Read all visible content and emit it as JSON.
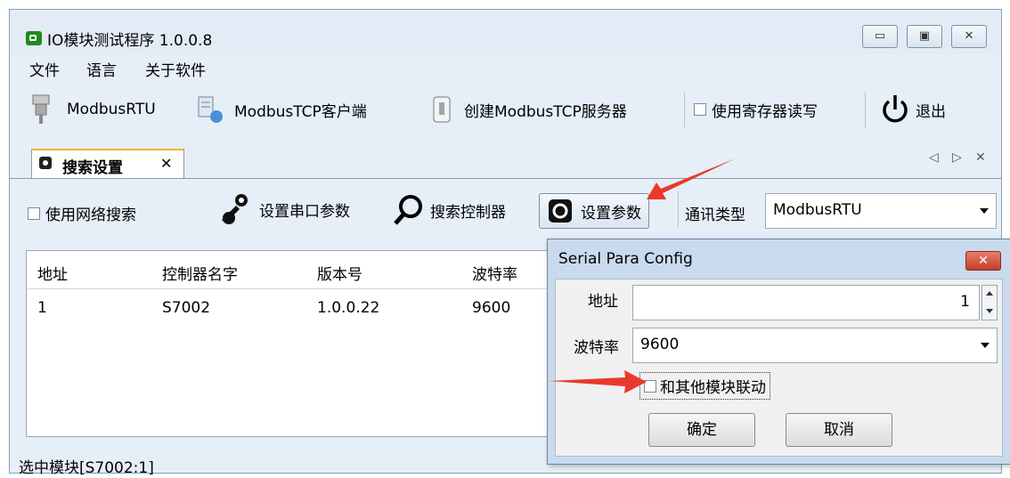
{
  "window": {
    "title": "IO模块测试程序 1.0.0.8",
    "minimize": "▭",
    "maximize": "▣",
    "close": "✕"
  },
  "menu": {
    "items": [
      "文件",
      "语言",
      "关于软件"
    ]
  },
  "toolbar": {
    "modbus_rtu": "ModbusRTU",
    "modbus_tcp_client": "ModbusTCP客户端",
    "create_tcp_server": "创建ModbusTCP服务器",
    "use_register": "使用寄存器读写",
    "exit": "退出"
  },
  "tab": {
    "label": "搜索设置",
    "close": "✕",
    "nav_prev": "◁",
    "nav_next": "▷",
    "nav_close": "✕"
  },
  "search": {
    "use_network": "使用网络搜索",
    "set_serial": "设置串口参数",
    "search_controller": "搜索控制器",
    "set_params": "设置参数",
    "comm_type_label": "通讯类型",
    "comm_type_value": "ModbusRTU"
  },
  "grid": {
    "headers": [
      "地址",
      "控制器名字",
      "版本号",
      "波特率"
    ],
    "rows": [
      [
        "1",
        "S7002",
        "1.0.0.22",
        "9600"
      ]
    ]
  },
  "status": {
    "text": "选中模块[S7002:1]"
  },
  "dialog": {
    "title": "Serial Para Config",
    "close": "✕",
    "address_label": "地址",
    "address_value": "1",
    "baud_label": "波特率",
    "baud_value": "9600",
    "link_label": "和其他模块联动",
    "ok": "确定",
    "cancel": "取消"
  },
  "colors": {
    "accent_arrow": "#e8392b",
    "tab_accent": "#f2b233"
  }
}
